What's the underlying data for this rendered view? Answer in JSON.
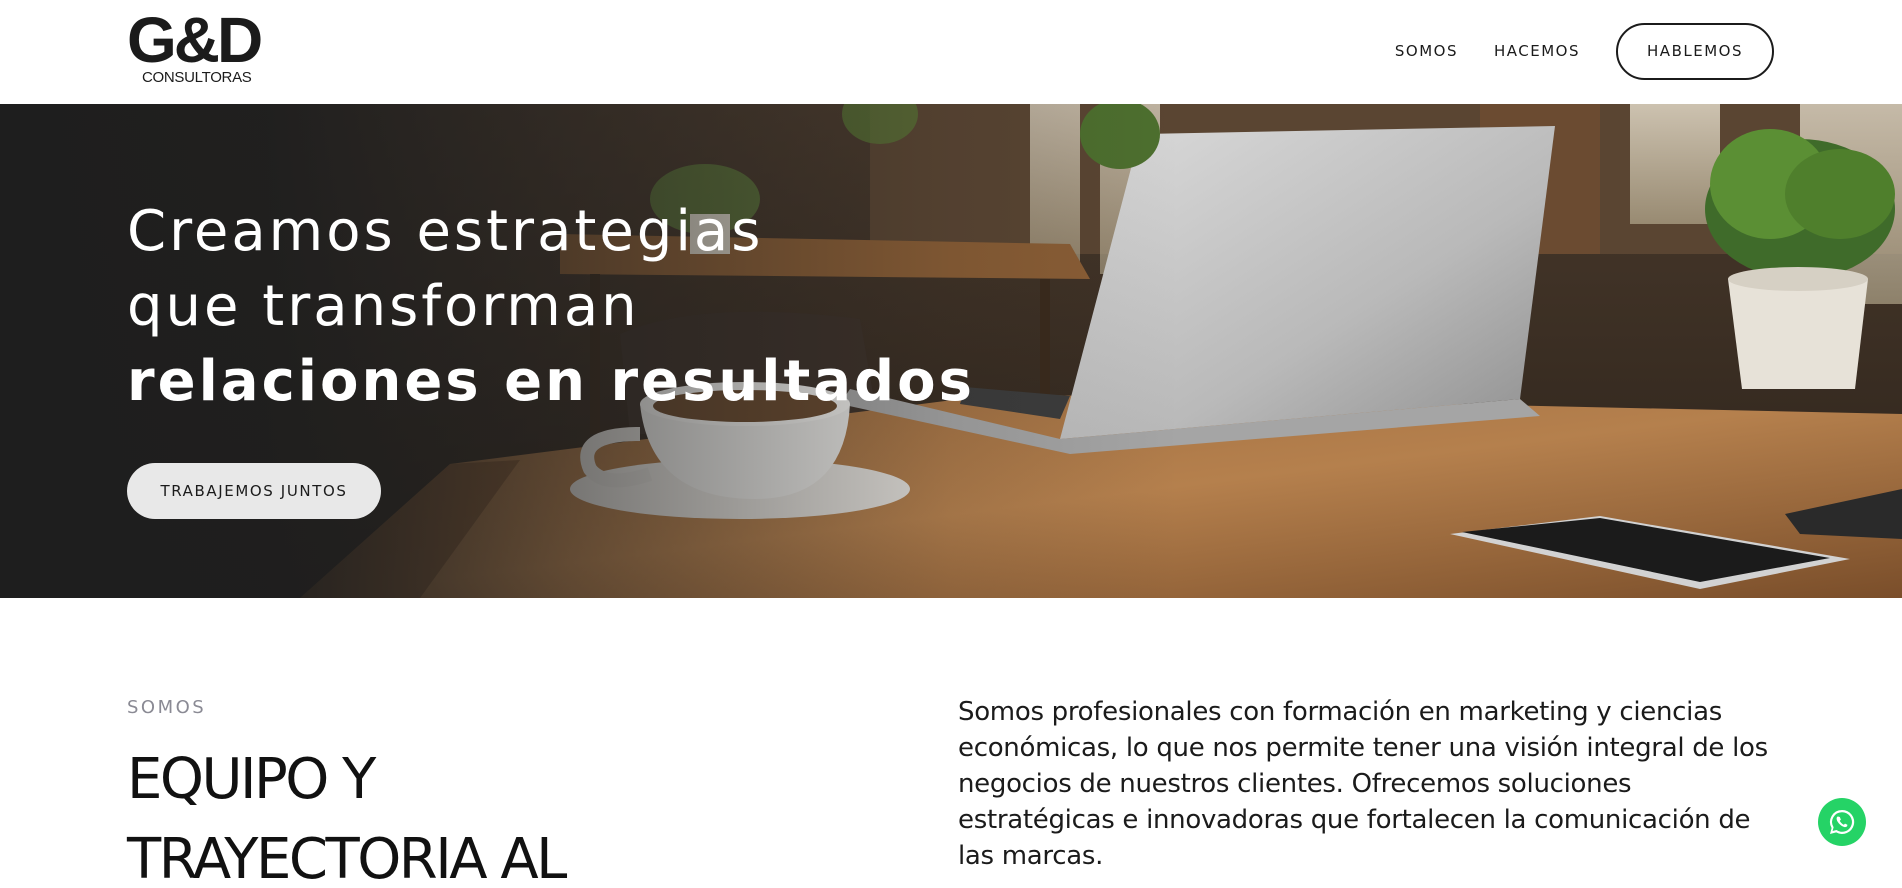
{
  "header": {
    "logo": {
      "main": "G&D",
      "sub": "CONSULTORAS"
    },
    "nav": [
      {
        "label": "SOMOS"
      },
      {
        "label": "HACEMOS"
      }
    ],
    "cta_label": "HABLEMOS"
  },
  "hero": {
    "title_line1": "Creamos estrategias",
    "title_line2": "que transforman",
    "title_line3": "relaciones en resultados",
    "cta_label": "TRABAJEMOS JUNTOS",
    "image_description": "laptop-on-wooden-table-with-coffee-cup-and-plant"
  },
  "about": {
    "eyebrow": "SOMOS",
    "title_line1": "EQUIPO Y",
    "title_line2": "TRAYECTORIA AL",
    "text": "Somos profesionales con formación en marketing y ciencias económicas, lo que nos permite tener una visión integral de los negocios de nuestros clientes. Ofrecemos soluciones estratégicas e innovadoras que fortalecen la comunicación de las marcas."
  },
  "floating": {
    "whatsapp_icon": "whatsapp-icon"
  },
  "colors": {
    "text": "#1b1b1b",
    "hero_dark": "#1e1e1e",
    "button_light": "#e8e8e8",
    "eyebrow": "#8a8a94",
    "whatsapp": "#25d366"
  }
}
